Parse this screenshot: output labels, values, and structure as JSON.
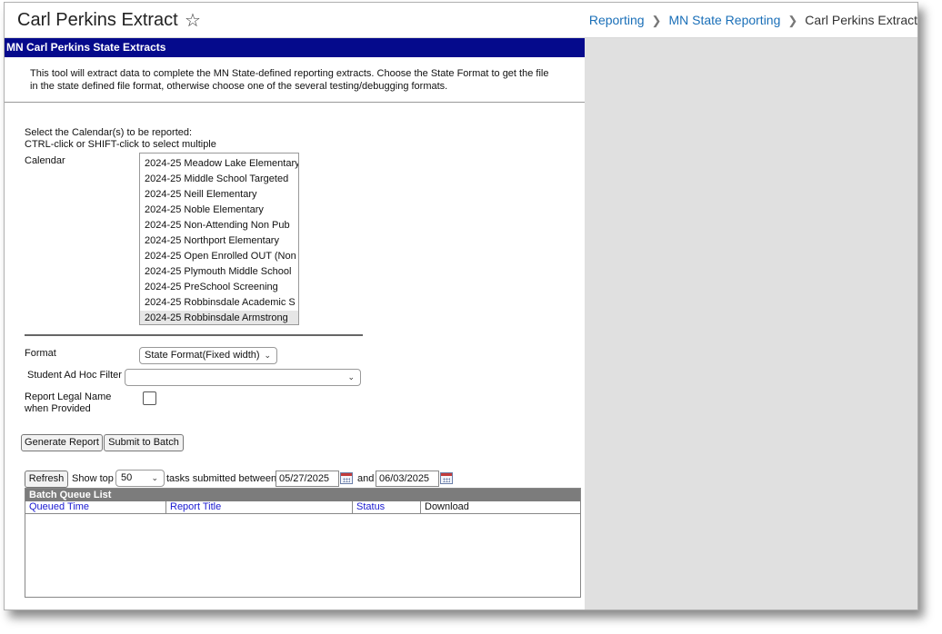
{
  "header": {
    "title": "Carl Perkins Extract",
    "star_icon": "star-outline-icon",
    "breadcrumbs": [
      "Reporting",
      "MN State Reporting",
      "Carl Perkins Extract"
    ]
  },
  "panel": {
    "title": "MN Carl Perkins State Extracts",
    "description": "This tool will extract data to complete the MN State-defined reporting extracts. Choose the State Format to get the file in the state defined file format, otherwise choose one of the several testing/debugging formats."
  },
  "calendar": {
    "instruction_line1": "Select the Calendar(s) to be reported:",
    "instruction_line2": "CTRL-click or SHIFT-click to select multiple",
    "label": "Calendar",
    "options": [
      "2024-25 Meadow Lake Elementary",
      "2024-25 Middle School Targeted",
      "2024-25 Neill Elementary",
      "2024-25 Noble Elementary",
      "2024-25 Non-Attending Non Pub",
      "2024-25 Northport Elementary",
      "2024-25 Open Enrolled OUT (Non",
      "2024-25 Plymouth Middle School",
      "2024-25 PreSchool Screening",
      "2024-25 Robbinsdale Academic S",
      "2024-25 Robbinsdale Armstrong"
    ],
    "selected": "2024-25 Robbinsdale Armstrong"
  },
  "format": {
    "label": "Format",
    "value": "State Format(Fixed width)"
  },
  "adhoc": {
    "label": "Student Ad Hoc Filter",
    "value": ""
  },
  "legal_name": {
    "label_line1": "Report Legal Name",
    "label_line2": "when Provided",
    "checked": false
  },
  "actions": {
    "generate": "Generate Report",
    "submit": "Submit to Batch"
  },
  "queue": {
    "refresh": "Refresh",
    "show_top": "Show top",
    "count": "50",
    "between": "tasks submitted between",
    "start_date": "05/27/2025",
    "and": "and",
    "end_date": "06/03/2025",
    "list_title": "Batch Queue List",
    "columns": [
      "Queued Time",
      "Report Title",
      "Status",
      "Download"
    ]
  }
}
